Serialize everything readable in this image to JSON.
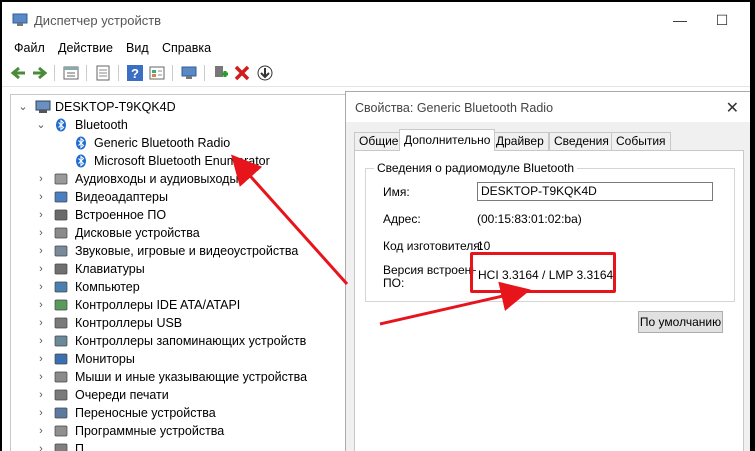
{
  "window": {
    "title": "Диспетчер устройств",
    "icon": "device-manager-icon"
  },
  "controls": {
    "minimize": "—",
    "maximize": "☐"
  },
  "menu": [
    "Файл",
    "Действие",
    "Вид",
    "Справка"
  ],
  "tree": {
    "root": "DESKTOP-T9KQK4D",
    "bluetooth": {
      "label": "Bluetooth",
      "children": [
        "Generic Bluetooth Radio",
        "Microsoft Bluetooth Enumerator"
      ]
    },
    "categories": [
      "Аудиовходы и аудиовыходы",
      "Видеоадаптеры",
      "Встроенное ПО",
      "Дисковые устройства",
      "Звуковые, игровые и видеоустройства",
      "Клавиатуры",
      "Компьютер",
      "Контроллеры IDE ATA/ATAPI",
      "Контроллеры USB",
      "Контроллеры запоминающих устройств",
      "Мониторы",
      "Мыши и иные указывающие устройства",
      "Очереди печати",
      "Переносные устройства",
      "Программные устройства",
      "П"
    ]
  },
  "dialog": {
    "title": "Свойства: Generic Bluetooth Radio",
    "close": "✕",
    "tabs": [
      "Общие",
      "Дополнительно",
      "Драйвер",
      "Сведения",
      "События"
    ],
    "active_tab": "Дополнительно",
    "group_title": "Сведения о радиомодуле Bluetooth",
    "name_label": "Имя:",
    "name_value": "DESKTOP-T9KQK4D",
    "address_label": "Адрес:",
    "address_value": "(00:15:83:01:02:ba)",
    "manufacturer_label": "Код изготовителя:",
    "manufacturer_value": "10",
    "firmware_label_1": "Версия встроенного",
    "firmware_label_2": "ПО:",
    "firmware_value": "HCI 3.3164  /  LMP 3.3164",
    "default_button": "По умолчанию"
  },
  "colors": {
    "annotation_red": "#e8141b",
    "accent": "#0063b1"
  }
}
